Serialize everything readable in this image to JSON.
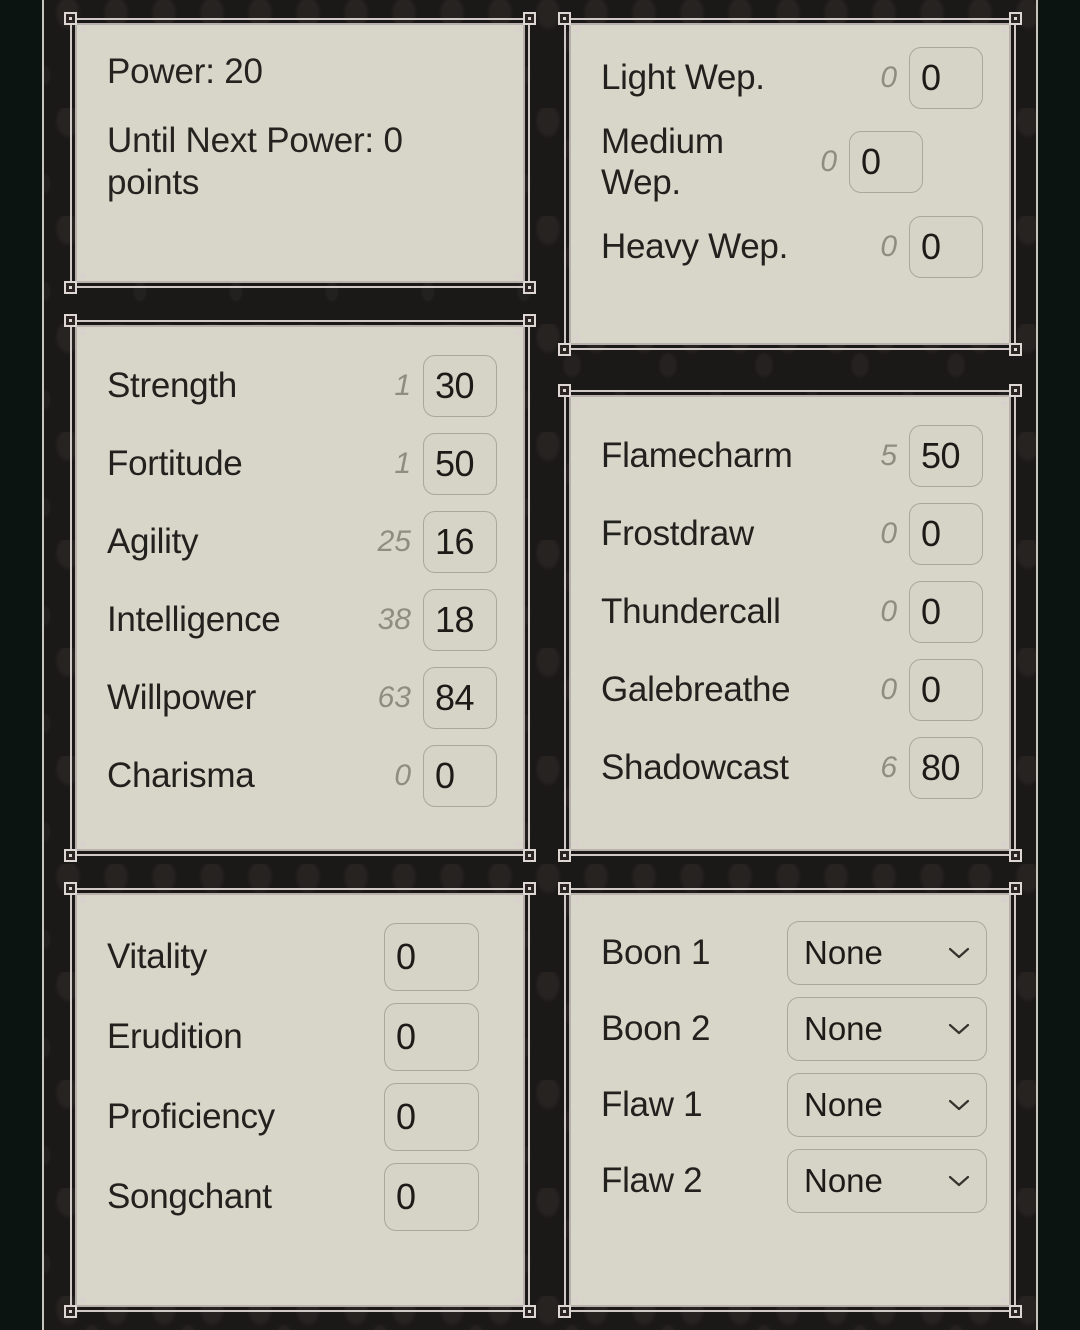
{
  "theme": {
    "page_background": "#0b1410",
    "frame_background": "#1b1918",
    "panel_fill": "#d7d6c9",
    "frame_line": "#cfc8c4",
    "text_primary": "#23211e",
    "text_muted": "#8d8d82",
    "field_border": "#a9a99b"
  },
  "panels": {
    "power": {
      "name": "power-panel",
      "lines": [
        "Power: 20",
        "Until Next Power: 0 points"
      ],
      "line1": "Power: 20",
      "line2": "Until Next Power: 0 points"
    },
    "weapons": {
      "name": "weapon-proficiency-panel",
      "rows": [
        {
          "label": "Light Wep.",
          "aux": "0",
          "value": "0"
        },
        {
          "label": "Medium Wep.",
          "aux": "0",
          "value": "0"
        },
        {
          "label": "Heavy Wep.",
          "aux": "0",
          "value": "0"
        }
      ]
    },
    "attributes": {
      "name": "attributes-panel",
      "rows": [
        {
          "label": "Strength",
          "aux": "1",
          "value": "30"
        },
        {
          "label": "Fortitude",
          "aux": "1",
          "value": "50"
        },
        {
          "label": "Agility",
          "aux": "25",
          "value": "16"
        },
        {
          "label": "Intelligence",
          "aux": "38",
          "value": "18"
        },
        {
          "label": "Willpower",
          "aux": "63",
          "value": "84"
        },
        {
          "label": "Charisma",
          "aux": "0",
          "value": "0"
        }
      ]
    },
    "attunements": {
      "name": "attunements-panel",
      "rows": [
        {
          "label": "Flamecharm",
          "aux": "5",
          "value": "50"
        },
        {
          "label": "Frostdraw",
          "aux": "0",
          "value": "0"
        },
        {
          "label": "Thundercall",
          "aux": "0",
          "value": "0"
        },
        {
          "label": "Galebreathe",
          "aux": "0",
          "value": "0"
        },
        {
          "label": "Shadowcast",
          "aux": "6",
          "value": "80"
        }
      ]
    },
    "talents": {
      "name": "secondary-stats-panel",
      "rows": [
        {
          "label": "Vitality",
          "value": "0"
        },
        {
          "label": "Erudition",
          "value": "0"
        },
        {
          "label": "Proficiency",
          "value": "0"
        },
        {
          "label": "Songchant",
          "value": "0"
        }
      ]
    },
    "boons_flaws": {
      "name": "boons-flaws-panel",
      "rows": [
        {
          "label": "Boon 1",
          "value": "None",
          "icon": "chevron-down-icon"
        },
        {
          "label": "Boon 2",
          "value": "None",
          "icon": "chevron-down-icon"
        },
        {
          "label": "Flaw 1",
          "value": "None",
          "icon": "chevron-down-icon"
        },
        {
          "label": "Flaw 2",
          "value": "None",
          "icon": "chevron-down-icon"
        }
      ]
    }
  }
}
